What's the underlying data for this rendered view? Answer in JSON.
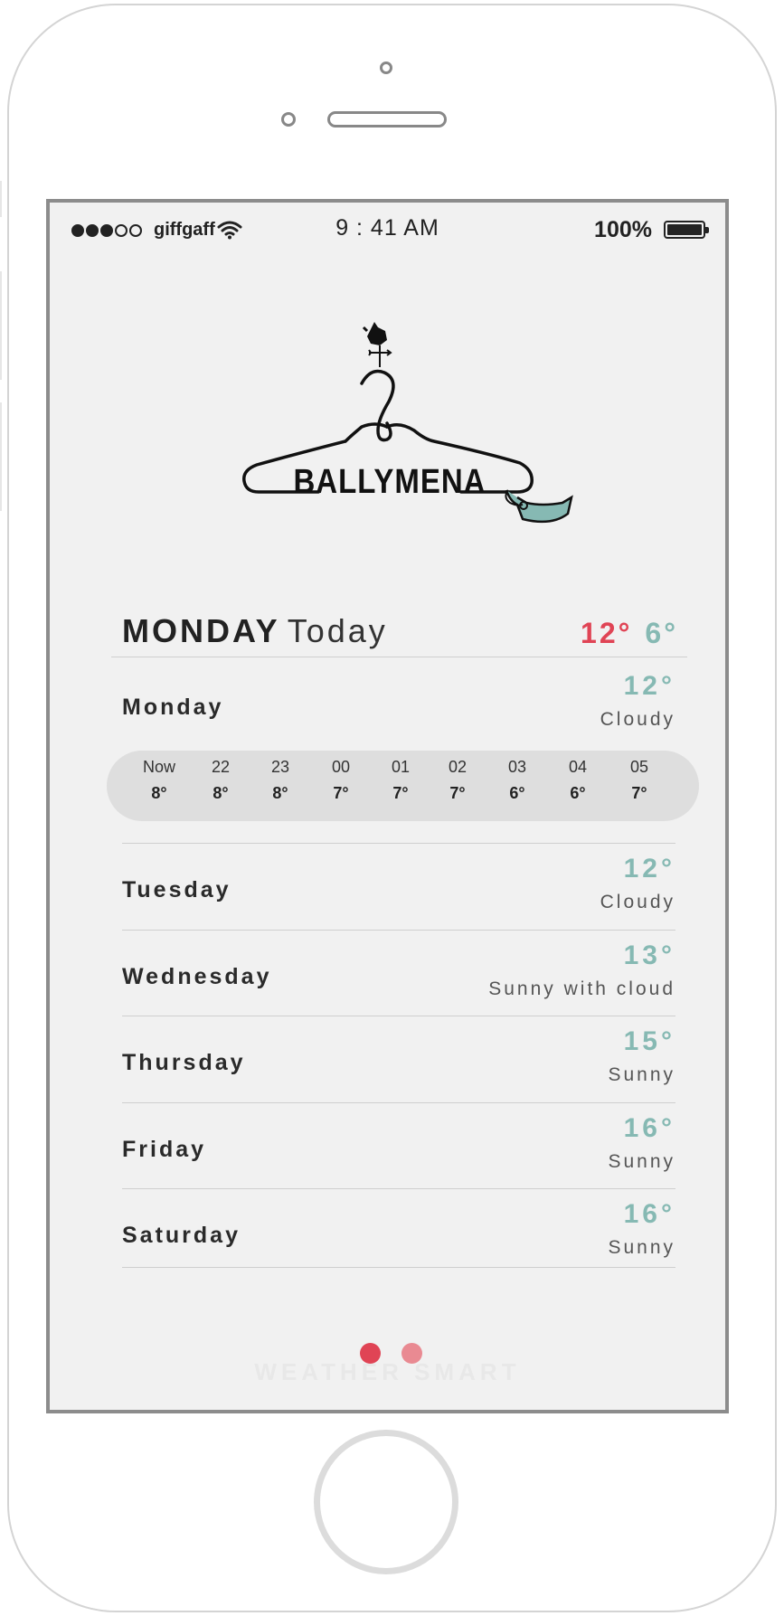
{
  "status_bar": {
    "carrier": "giffgaff",
    "time": "9 : 41 AM",
    "battery": "100%"
  },
  "logo": {
    "text": "BALLYMENA"
  },
  "today": {
    "day": "MONDAY",
    "label": "Today",
    "high": "12°",
    "low": "6°"
  },
  "current": {
    "day": "Monday",
    "temp": "12°",
    "desc": "Cloudy"
  },
  "hourly": [
    {
      "time": "Now",
      "temp": "8°"
    },
    {
      "time": "22",
      "temp": "8°"
    },
    {
      "time": "23",
      "temp": "8°"
    },
    {
      "time": "00",
      "temp": "7°"
    },
    {
      "time": "01",
      "temp": "7°"
    },
    {
      "time": "02",
      "temp": "7°"
    },
    {
      "time": "03",
      "temp": "6°"
    },
    {
      "time": "04",
      "temp": "6°"
    },
    {
      "time": "05",
      "temp": "7°"
    }
  ],
  "forecast": [
    {
      "day": "Tuesday",
      "temp": "12°",
      "desc": "Cloudy"
    },
    {
      "day": "Wednesday",
      "temp": "13°",
      "desc": "Sunny with cloud"
    },
    {
      "day": "Thursday",
      "temp": "15°",
      "desc": "Sunny"
    },
    {
      "day": "Friday",
      "temp": "16°",
      "desc": "Sunny"
    },
    {
      "day": "Saturday",
      "temp": "16°",
      "desc": "Sunny"
    }
  ],
  "watermark": "WEATHER SMART",
  "colors": {
    "accent_red": "#e04455",
    "accent_teal": "#86b9b3",
    "screen_bg": "#f1f1f1"
  }
}
